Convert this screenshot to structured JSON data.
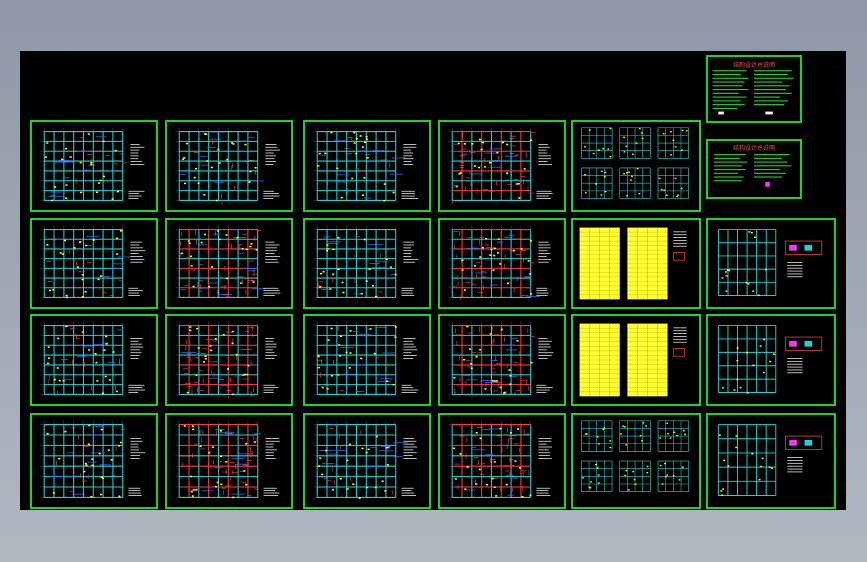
{
  "viewer": {
    "background_top": "#8e98a6",
    "background_bottom": "#b1b8c2",
    "model_space_color": "#000000"
  },
  "palette": {
    "frame": "#21d321",
    "beam_cyan": "#19d6d6",
    "beam_blue": "#3a6bff",
    "rebar_red": "#ff3b3b",
    "column_yellow": "#ffff00",
    "text_white": "#f0f0f0",
    "table_yellow": "#ffff33",
    "legend_magenta": "#ff33ff"
  },
  "notes_sheet": {
    "title": "结构设计总说明"
  },
  "notes_sheet_2": {
    "title": "结构设计总说明"
  },
  "drawing_sheets": [
    {
      "id": "s-r1-c1",
      "kind": "plan"
    },
    {
      "id": "s-r1-c2",
      "kind": "plan"
    },
    {
      "id": "s-r1-c3",
      "kind": "plan"
    },
    {
      "id": "s-r1-c4",
      "kind": "plan"
    },
    {
      "id": "s-r1-c5",
      "kind": "details"
    },
    {
      "id": "s-r2-c1",
      "kind": "plan"
    },
    {
      "id": "s-r2-c2",
      "kind": "plan"
    },
    {
      "id": "s-r2-c3",
      "kind": "plan"
    },
    {
      "id": "s-r2-c4",
      "kind": "plan"
    },
    {
      "id": "s-r2-c5",
      "kind": "table"
    },
    {
      "id": "s-r2-c6",
      "kind": "plan-detail"
    },
    {
      "id": "s-r3-c1",
      "kind": "plan"
    },
    {
      "id": "s-r3-c2",
      "kind": "plan"
    },
    {
      "id": "s-r3-c3",
      "kind": "plan"
    },
    {
      "id": "s-r3-c4",
      "kind": "plan"
    },
    {
      "id": "s-r3-c5",
      "kind": "table"
    },
    {
      "id": "s-r3-c6",
      "kind": "plan-detail"
    },
    {
      "id": "s-r4-c1",
      "kind": "plan"
    },
    {
      "id": "s-r4-c2",
      "kind": "plan"
    },
    {
      "id": "s-r4-c3",
      "kind": "plan"
    },
    {
      "id": "s-r4-c4",
      "kind": "plan"
    },
    {
      "id": "s-r4-c5",
      "kind": "details"
    },
    {
      "id": "s-r4-c6",
      "kind": "plan-detail"
    }
  ]
}
